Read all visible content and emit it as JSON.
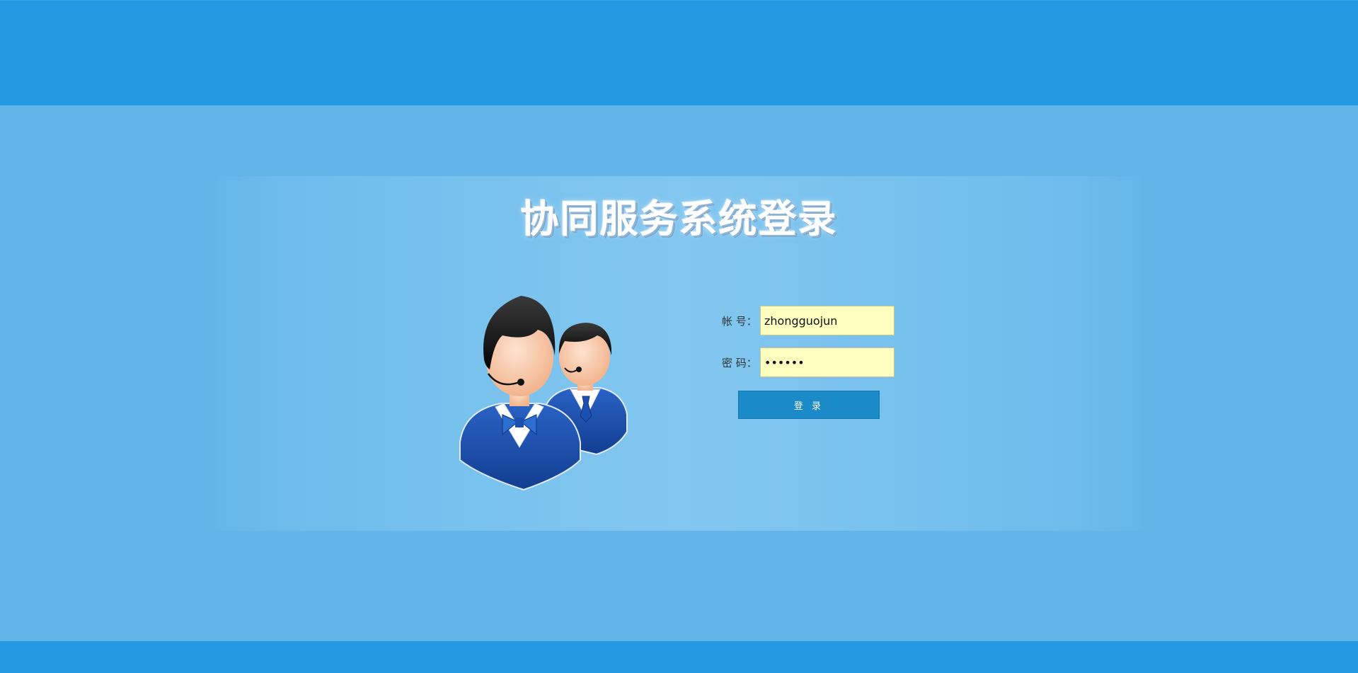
{
  "page": {
    "title": "协同服务系统登录"
  },
  "login_form": {
    "account_label": "帐 号：",
    "account_value": "zhongguojun",
    "password_label": "密 码：",
    "password_value": "••••••",
    "submit_label": "登 录"
  },
  "icons": {
    "avatar": "customer-service-agents-icon"
  },
  "colors": {
    "header_band": "#2299e0",
    "background": "#62b5e8",
    "input_background": "#ffffbf",
    "button_background": "#1a8ac8"
  }
}
